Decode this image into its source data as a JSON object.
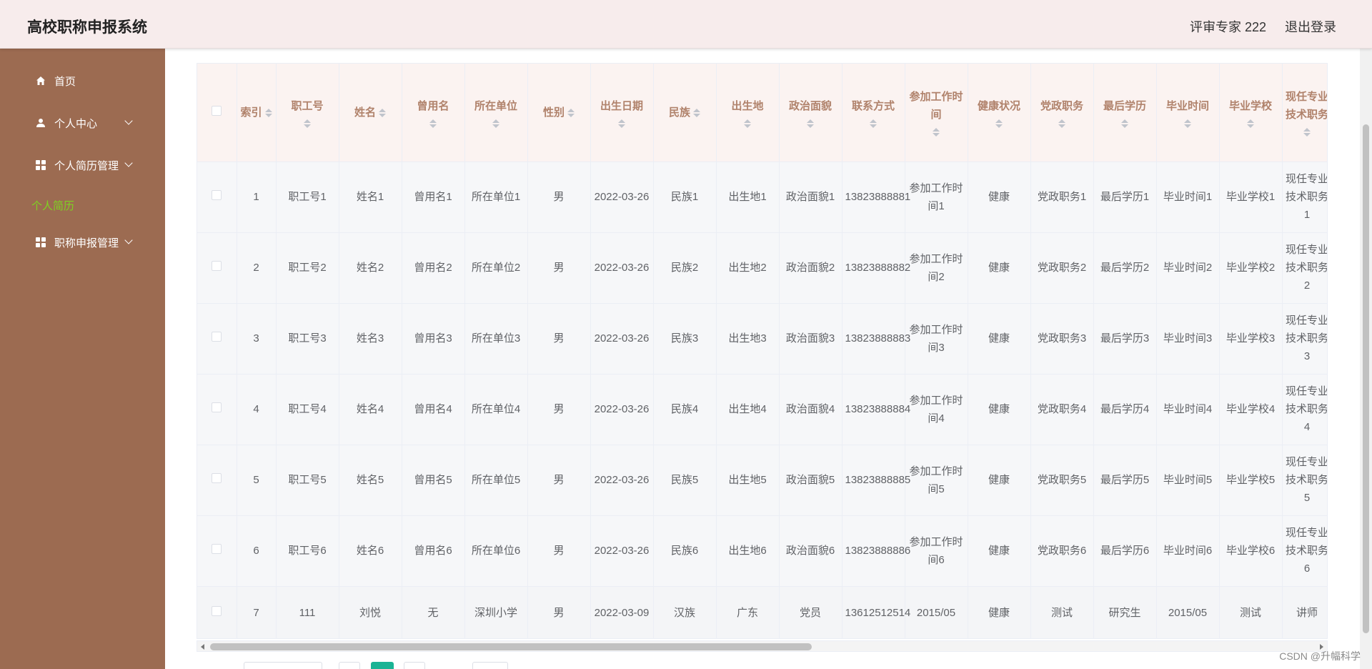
{
  "app": {
    "title": "高校职称申报系统"
  },
  "header": {
    "user_label": "评审专家 222",
    "logout_label": "退出登录"
  },
  "sidebar": {
    "items": [
      {
        "label": "首页",
        "icon": "home-icon"
      },
      {
        "label": "个人中心",
        "icon": "user-icon"
      },
      {
        "label": "个人简历管理",
        "icon": "grid-icon"
      },
      {
        "label": "职称申报管理",
        "icon": "grid-icon"
      }
    ],
    "active_submenu": "个人简历",
    "submenu_color": "#7ed321"
  },
  "table": {
    "headers": [
      "索引",
      "职工号",
      "姓名",
      "曾用名",
      "所在单位",
      "性别",
      "出生日期",
      "民族",
      "出生地",
      "政治面貌",
      "联系方式",
      "参加工作时间",
      "健康状况",
      "党政职务",
      "最后学历",
      "毕业时间",
      "毕业学校",
      "现任专业技术职务"
    ],
    "rows": [
      [
        "1",
        "职工号1",
        "姓名1",
        "曾用名1",
        "所在单位1",
        "男",
        "2022-03-26",
        "民族1",
        "出生地1",
        "政治面貌1",
        "13823888881",
        "参加工作时间1",
        "健康",
        "党政职务1",
        "最后学历1",
        "毕业时间1",
        "毕业学校1",
        "现任专业技术职务1"
      ],
      [
        "2",
        "职工号2",
        "姓名2",
        "曾用名2",
        "所在单位2",
        "男",
        "2022-03-26",
        "民族2",
        "出生地2",
        "政治面貌2",
        "13823888882",
        "参加工作时间2",
        "健康",
        "党政职务2",
        "最后学历2",
        "毕业时间2",
        "毕业学校2",
        "现任专业技术职务2"
      ],
      [
        "3",
        "职工号3",
        "姓名3",
        "曾用名3",
        "所在单位3",
        "男",
        "2022-03-26",
        "民族3",
        "出生地3",
        "政治面貌3",
        "13823888883",
        "参加工作时间3",
        "健康",
        "党政职务3",
        "最后学历3",
        "毕业时间3",
        "毕业学校3",
        "现任专业技术职务3"
      ],
      [
        "4",
        "职工号4",
        "姓名4",
        "曾用名4",
        "所在单位4",
        "男",
        "2022-03-26",
        "民族4",
        "出生地4",
        "政治面貌4",
        "13823888884",
        "参加工作时间4",
        "健康",
        "党政职务4",
        "最后学历4",
        "毕业时间4",
        "毕业学校4",
        "现任专业技术职务4"
      ],
      [
        "5",
        "职工号5",
        "姓名5",
        "曾用名5",
        "所在单位5",
        "男",
        "2022-03-26",
        "民族5",
        "出生地5",
        "政治面貌5",
        "13823888885",
        "参加工作时间5",
        "健康",
        "党政职务5",
        "最后学历5",
        "毕业时间5",
        "毕业学校5",
        "现任专业技术职务5"
      ],
      [
        "6",
        "职工号6",
        "姓名6",
        "曾用名6",
        "所在单位6",
        "男",
        "2022-03-26",
        "民族6",
        "出生地6",
        "政治面貌6",
        "13823888886",
        "参加工作时间6",
        "健康",
        "党政职务6",
        "最后学历6",
        "毕业时间6",
        "毕业学校6",
        "现任专业技术职务6"
      ],
      [
        "7",
        "111",
        "刘悦",
        "无",
        "深圳小学",
        "男",
        "2022-03-09",
        "汉族",
        "广东",
        "党员",
        "13612512514",
        "2015/05",
        "健康",
        "测试",
        "研究生",
        "2015/05",
        "测试",
        "讲师"
      ]
    ]
  },
  "colors": {
    "sidebar": "#9c6b51",
    "header_bg": "#f7ecec",
    "table_header_text": "#b0826b",
    "pager_active": "#1ab394"
  },
  "watermark": "CSDN @升幅科学"
}
